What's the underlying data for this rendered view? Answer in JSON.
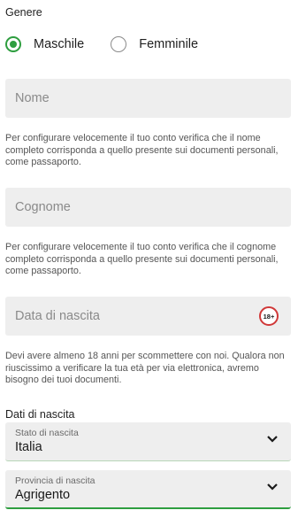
{
  "gender": {
    "label": "Genere",
    "options": [
      {
        "label": "Maschile",
        "selected": true
      },
      {
        "label": "Femminile",
        "selected": false
      }
    ]
  },
  "first_name": {
    "placeholder": "Nome",
    "help": "Per configurare velocemente il tuo conto verifica che il nome completo corrisponda a quello presente sui documenti personali, come passaporto."
  },
  "last_name": {
    "placeholder": "Cognome",
    "help": "Per configurare velocemente il tuo conto verifica che il cognome completo corrisponda a quello presente sui documenti personali, come passaporto."
  },
  "birth_date": {
    "placeholder": "Data di nascita",
    "badge": "18+",
    "help": "Devi avere almeno 18 anni per scommettere con noi. Qualora non riuscissimo a verificare la tua età per via elettronica, avremo bisogno dei tuoi documenti."
  },
  "birth_data": {
    "label": "Dati di nascita",
    "country": {
      "label": "Stato di nascita",
      "value": "Italia"
    },
    "province": {
      "label": "Provincia di nascita",
      "value": "Agrigento"
    }
  },
  "colors": {
    "accent": "#2e9e3f",
    "badge_ring": "#d03838",
    "field_bg": "#eeeeee"
  },
  "icons": {
    "select_arrow": "chevron-down-icon",
    "radio": "radio-icon"
  }
}
